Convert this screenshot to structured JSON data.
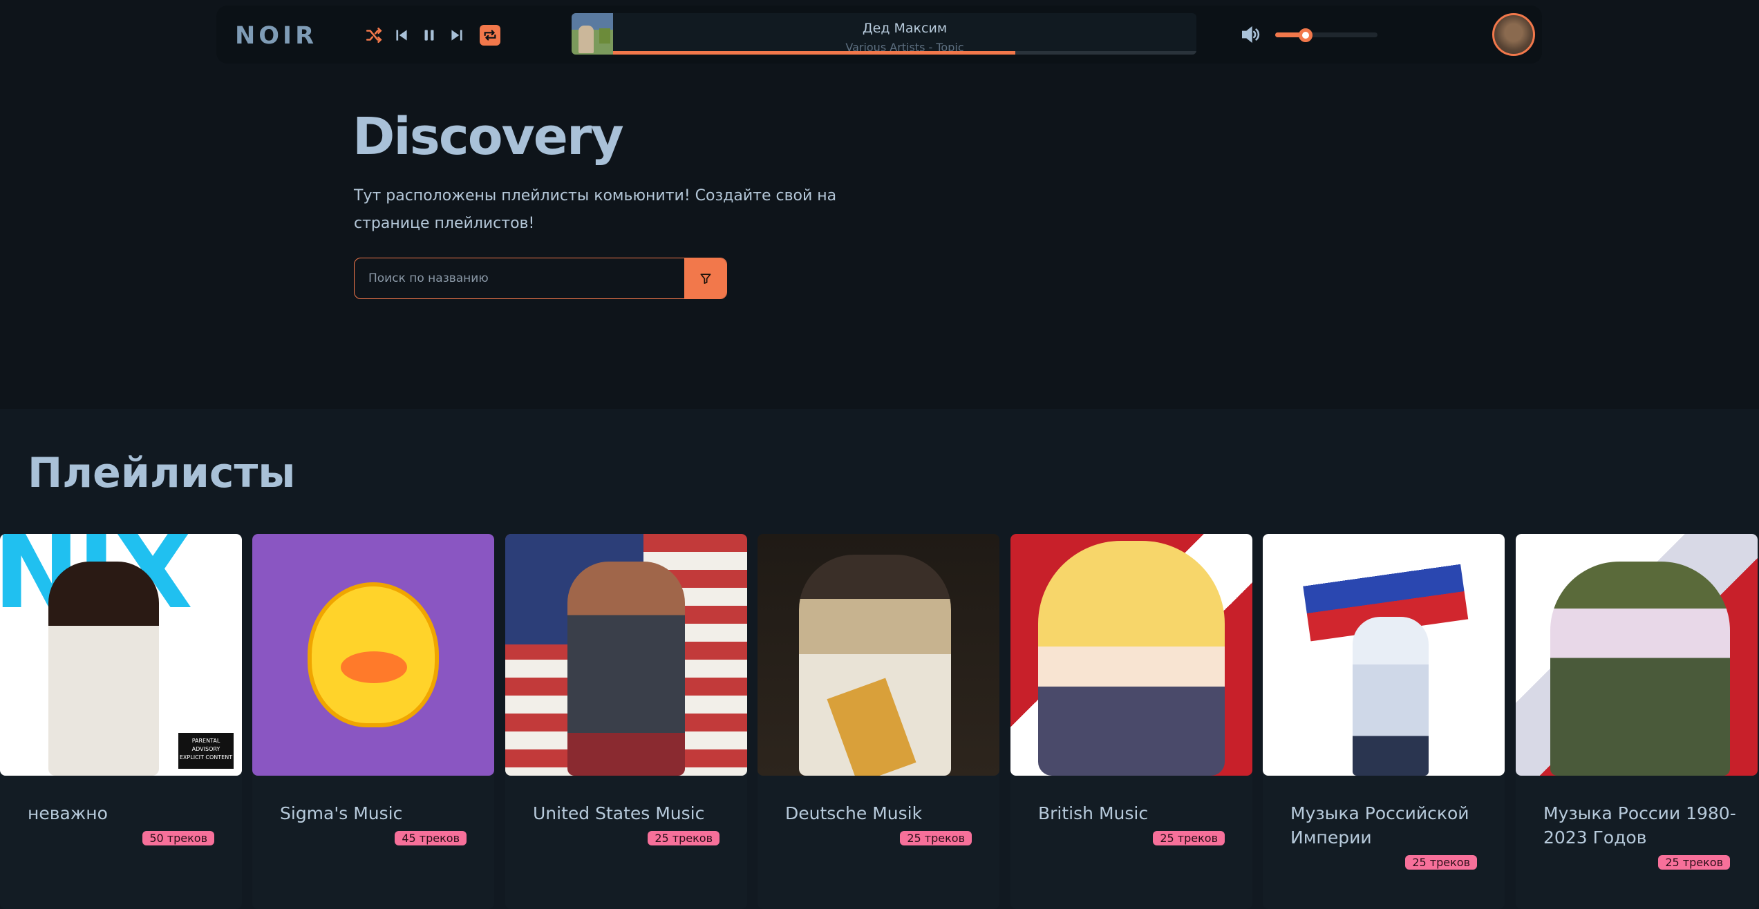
{
  "topbar": {
    "logo": "NOIR",
    "icons": {
      "shuffle": "shuffle-icon",
      "previous": "previous-icon",
      "pause": "pause-icon",
      "next": "next-icon",
      "repeat": "repeat-icon",
      "volume": "volume-icon"
    },
    "now_playing": {
      "title": "Дед Максим",
      "artist": "Various Artists - Topic",
      "progress": 0.69
    },
    "volume_level": 0.3
  },
  "hero": {
    "title": "Discovery",
    "description": "Тут расположены плейлисты комьюнити! Создайте свой на странице плейлистов!",
    "search_placeholder": "Поиск по названию"
  },
  "playlists": {
    "title": "Плейлисты",
    "items": [
      {
        "name": "неважно",
        "tracks": "50 треков"
      },
      {
        "name": "Sigma's Music",
        "tracks": "45 треков"
      },
      {
        "name": "United States Music",
        "tracks": "25 треков"
      },
      {
        "name": "Deutsche Musik",
        "tracks": "25 треков"
      },
      {
        "name": "British Music",
        "tracks": "25 треков"
      },
      {
        "name": "Музыка Российской Империи",
        "tracks": "25 треков"
      },
      {
        "name": "Музыка России 1980-2023 Годов",
        "tracks": "25 треков"
      }
    ]
  },
  "colors": {
    "accent": "#f2784b",
    "badge": "#f7709a",
    "background": "#0e141a"
  }
}
